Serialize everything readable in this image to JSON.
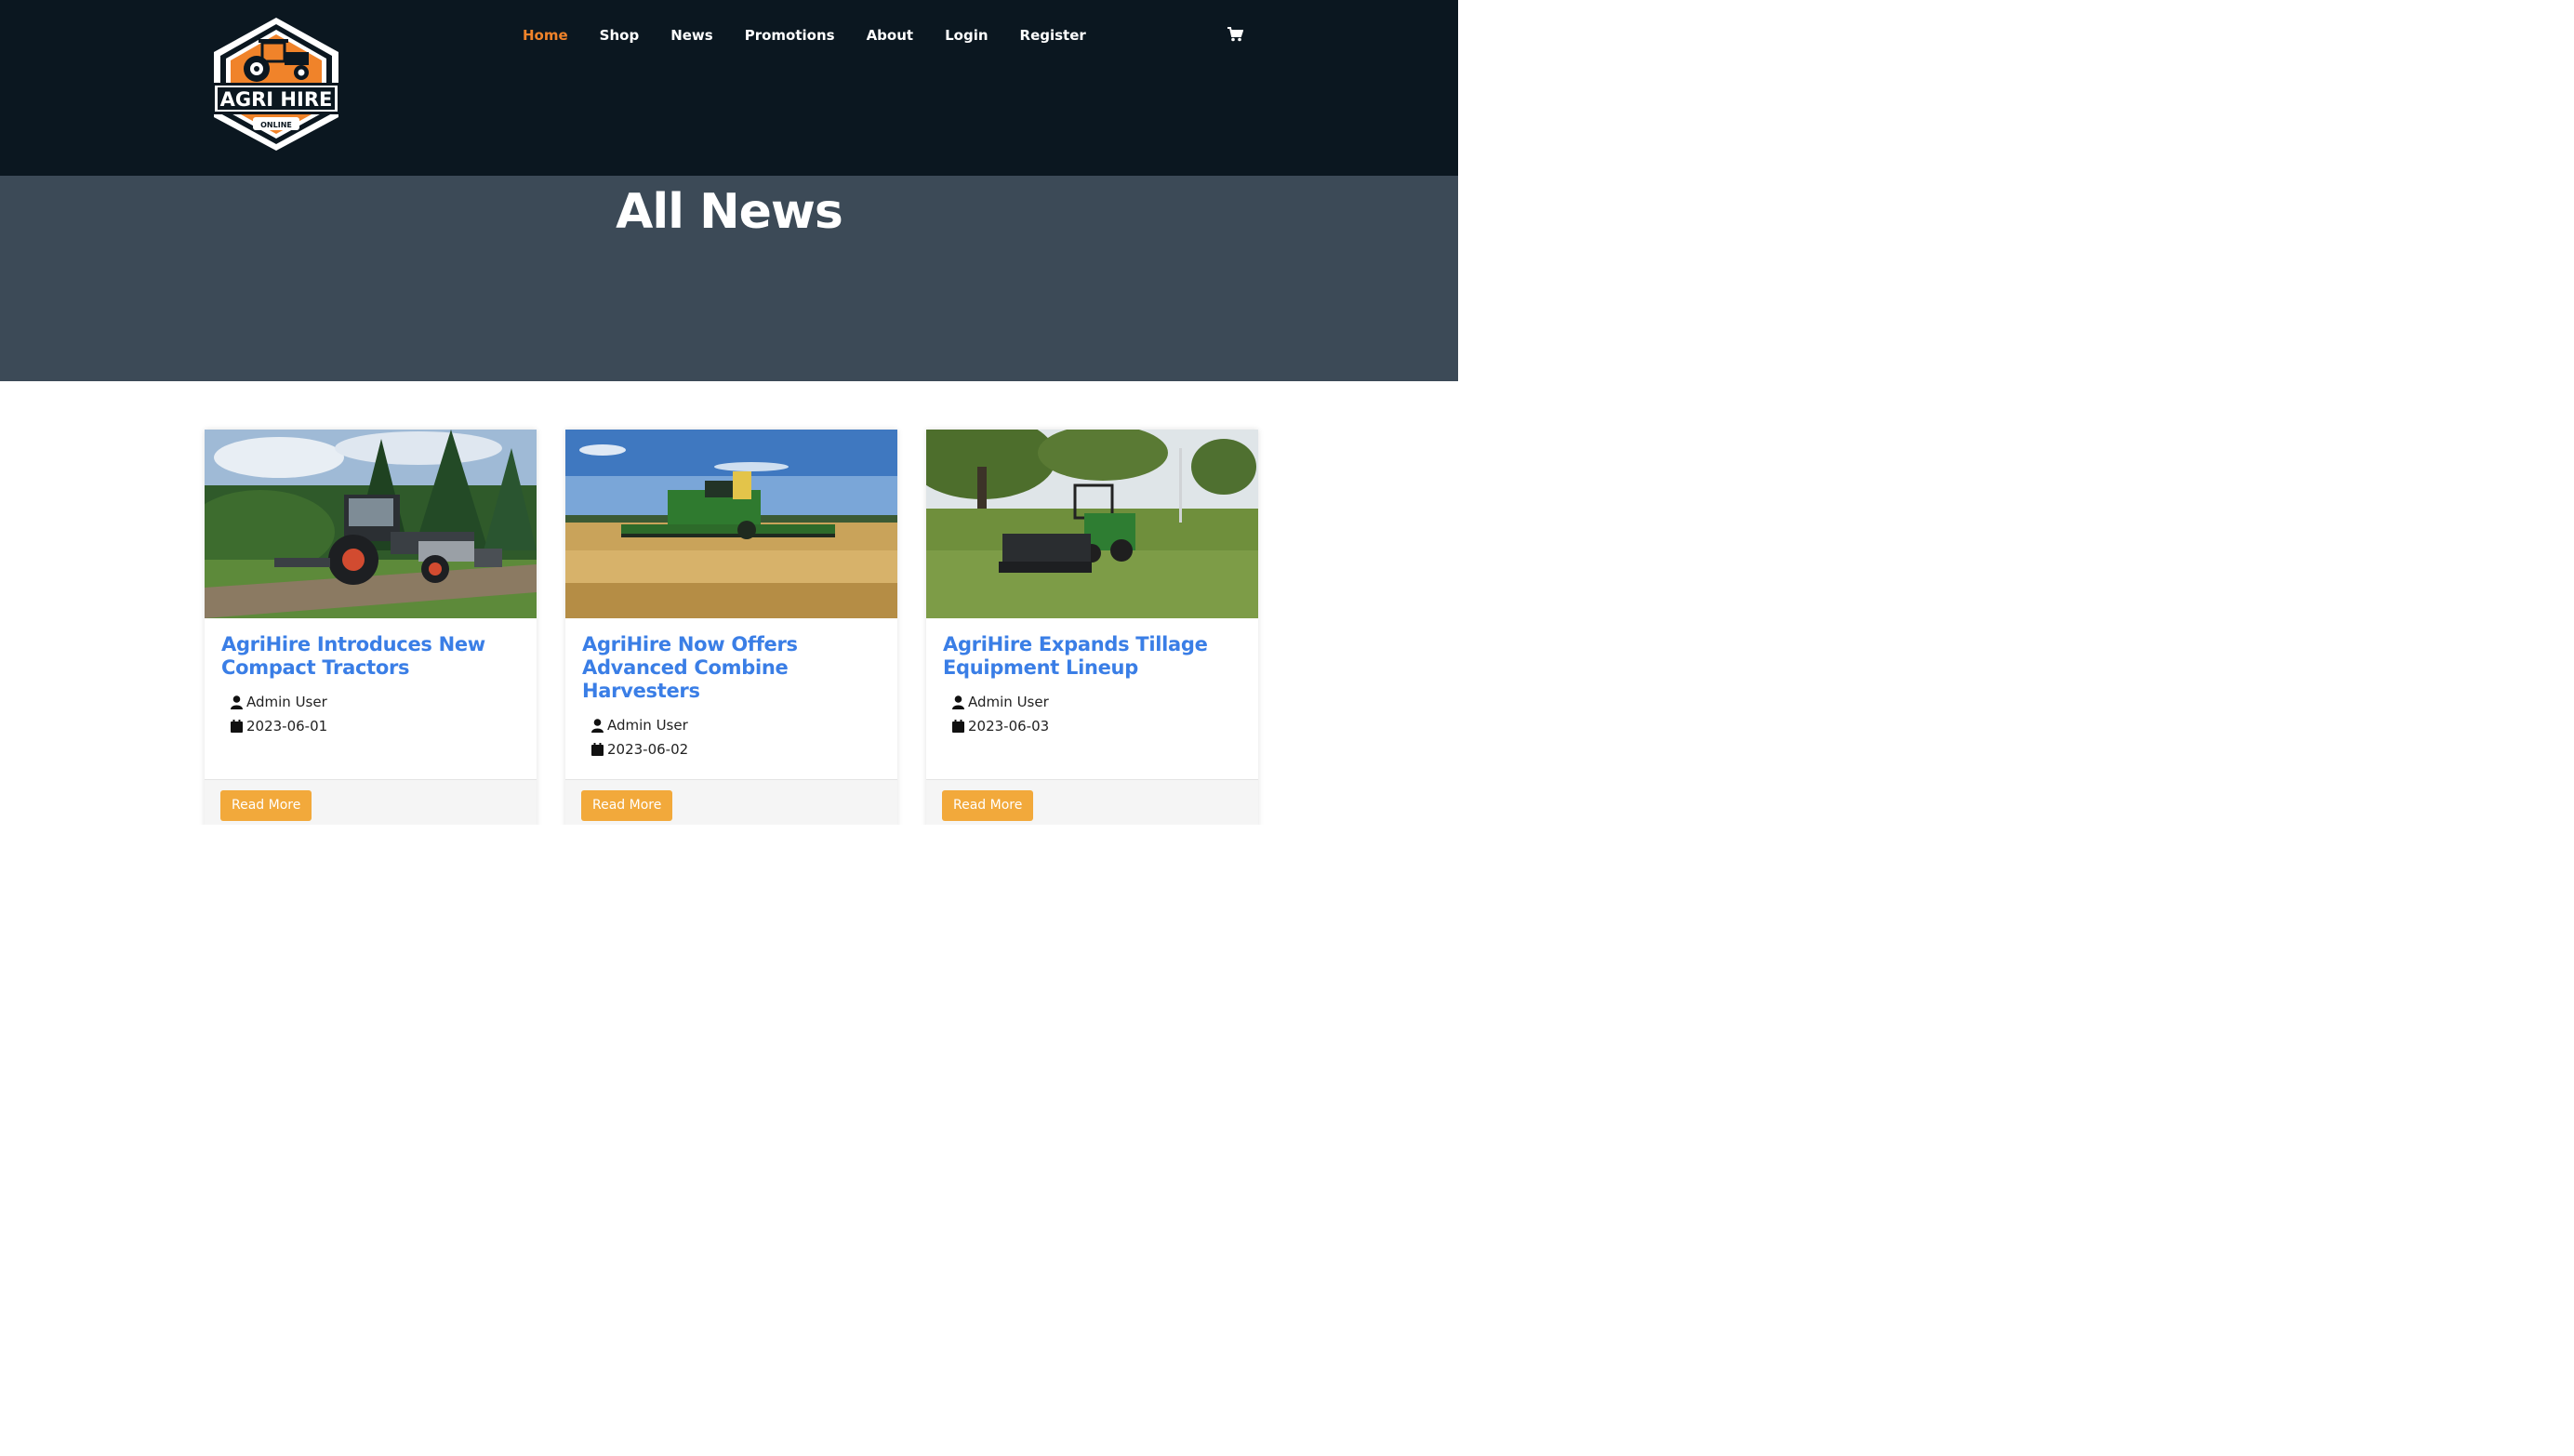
{
  "brand": {
    "name": "AGRI HIRE",
    "tagline": "ONLINE",
    "accent": "#f0832a"
  },
  "nav": {
    "items": [
      {
        "label": "Home",
        "active": true
      },
      {
        "label": "Shop"
      },
      {
        "label": "News"
      },
      {
        "label": "Promotions"
      },
      {
        "label": "About"
      },
      {
        "label": "Login"
      },
      {
        "label": "Register"
      }
    ],
    "cart_icon": "cart-icon"
  },
  "hero": {
    "title": "All News"
  },
  "cards": [
    {
      "title": "AgriHire Introduces New Compact Tractors",
      "author": "Admin User",
      "date": "2023-06-01",
      "button": "Read More"
    },
    {
      "title": "AgriHire Now Offers Advanced Combine Harvesters",
      "author": "Admin User",
      "date": "2023-06-02",
      "button": "Read More"
    },
    {
      "title": "AgriHire Expands Tillage Equipment Lineup",
      "author": "Admin User",
      "date": "2023-06-03",
      "button": "Read More"
    }
  ],
  "colors": {
    "header_bg": "#0b1720",
    "hero_bg": "#3c4a57",
    "link_title": "#3a7ee6",
    "button_bg": "#f2a93b"
  }
}
